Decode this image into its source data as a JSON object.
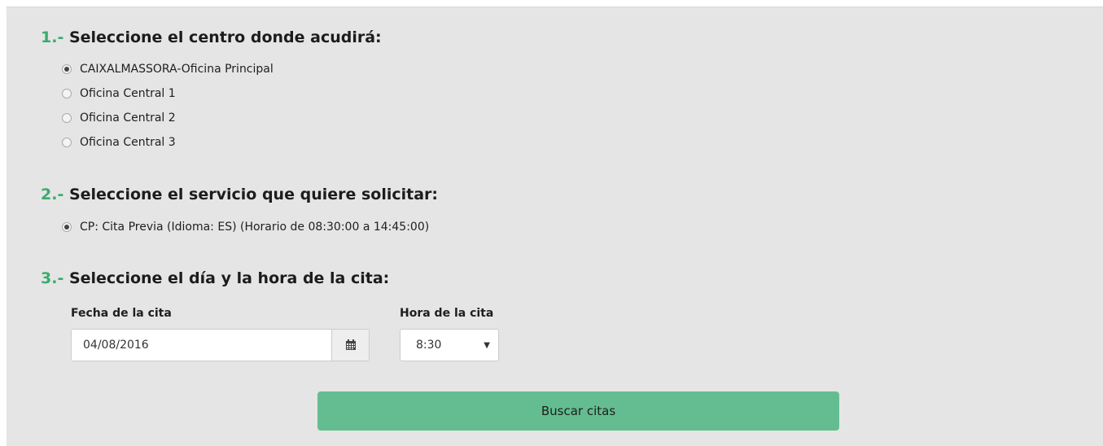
{
  "section1": {
    "number": "1.-",
    "title": "Seleccione el centro donde acudirá:",
    "options": [
      {
        "label": "CAIXALMASSORA-Oficina Principal",
        "selected": true
      },
      {
        "label": "Oficina Central 1",
        "selected": false
      },
      {
        "label": "Oficina Central 2",
        "selected": false
      },
      {
        "label": "Oficina Central 3",
        "selected": false
      }
    ]
  },
  "section2": {
    "number": "2.-",
    "title": "Seleccione el servicio que quiere solicitar:",
    "options": [
      {
        "label": "CP: Cita Previa (Idioma: ES) (Horario de 08:30:00 a 14:45:00)",
        "selected": true
      }
    ]
  },
  "section3": {
    "number": "3.-",
    "title": "Seleccione el día y la hora de la cita:",
    "date_label": "Fecha de la cita",
    "date_value": "04/08/2016",
    "time_label": "Hora de la cita",
    "time_value": "8:30"
  },
  "search_button_label": "Buscar citas",
  "icons": {
    "calendar": "calendar-icon",
    "dropdown": "chevron-down-icon"
  },
  "colors": {
    "accent": "#3aac6c",
    "button": "#64bd91",
    "panel": "#e5e5e5"
  }
}
